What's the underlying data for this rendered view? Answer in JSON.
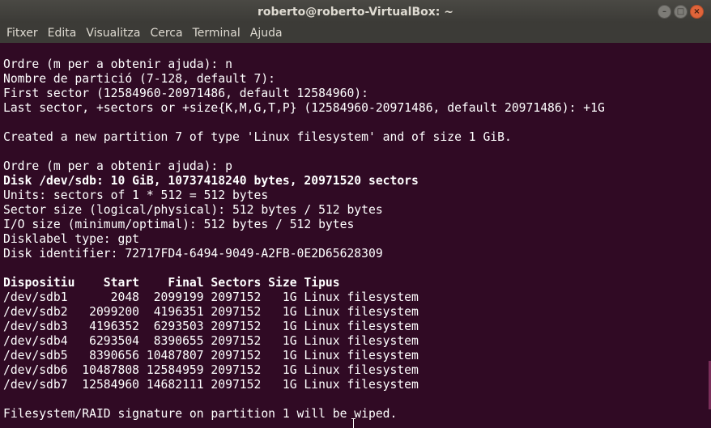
{
  "window": {
    "title": "roberto@roberto-VirtualBox: ~"
  },
  "menu": [
    "Fitxer",
    "Edita",
    "Visualitza",
    "Cerca",
    "Terminal",
    "Ajuda"
  ],
  "terminal": {
    "lines": [
      {
        "text": "Ordre (m per a obtenir ajuda): n",
        "bold": false
      },
      {
        "text": "Nombre de partició (7-128, default 7):",
        "bold": false
      },
      {
        "text": "First sector (12584960-20971486, default 12584960):",
        "bold": false
      },
      {
        "text": "Last sector, +sectors or +size{K,M,G,T,P} (12584960-20971486, default 20971486): +1G",
        "bold": false
      },
      {
        "text": "",
        "bold": false
      },
      {
        "text": "Created a new partition 7 of type 'Linux filesystem' and of size 1 GiB.",
        "bold": false
      },
      {
        "text": "",
        "bold": false
      },
      {
        "text": "Ordre (m per a obtenir ajuda): p",
        "bold": false
      },
      {
        "text": "Disk /dev/sdb: 10 GiB, 10737418240 bytes, 20971520 sectors",
        "bold": true
      },
      {
        "text": "Units: sectors of 1 * 512 = 512 bytes",
        "bold": false
      },
      {
        "text": "Sector size (logical/physical): 512 bytes / 512 bytes",
        "bold": false
      },
      {
        "text": "I/O size (minimum/optimal): 512 bytes / 512 bytes",
        "bold": false
      },
      {
        "text": "Disklabel type: gpt",
        "bold": false
      },
      {
        "text": "Disk identifier: 72717FD4-6494-9049-A2FB-0E2D65628309",
        "bold": false
      },
      {
        "text": "",
        "bold": false
      },
      {
        "text": "Dispositiu    Start    Final Sectors Size Tipus",
        "bold": true
      },
      {
        "text": "/dev/sdb1      2048  2099199 2097152   1G Linux filesystem",
        "bold": false
      },
      {
        "text": "/dev/sdb2   2099200  4196351 2097152   1G Linux filesystem",
        "bold": false
      },
      {
        "text": "/dev/sdb3   4196352  6293503 2097152   1G Linux filesystem",
        "bold": false
      },
      {
        "text": "/dev/sdb4   6293504  8390655 2097152   1G Linux filesystem",
        "bold": false
      },
      {
        "text": "/dev/sdb5   8390656 10487807 2097152   1G Linux filesystem",
        "bold": false
      },
      {
        "text": "/dev/sdb6  10487808 12584959 2097152   1G Linux filesystem",
        "bold": false
      },
      {
        "text": "/dev/sdb7  12584960 14682111 2097152   1G Linux filesystem",
        "bold": false
      },
      {
        "text": "",
        "bold": false
      },
      {
        "text": "Filesystem/RAID signature on partition 1 will be wiped.",
        "bold": false
      }
    ]
  },
  "colors": {
    "background": "#300a24",
    "foreground": "#ffffff",
    "titlebar": "#3c3b37",
    "close": "#e0643a"
  },
  "icons": [
    "minimize-icon",
    "maximize-icon",
    "close-icon"
  ]
}
